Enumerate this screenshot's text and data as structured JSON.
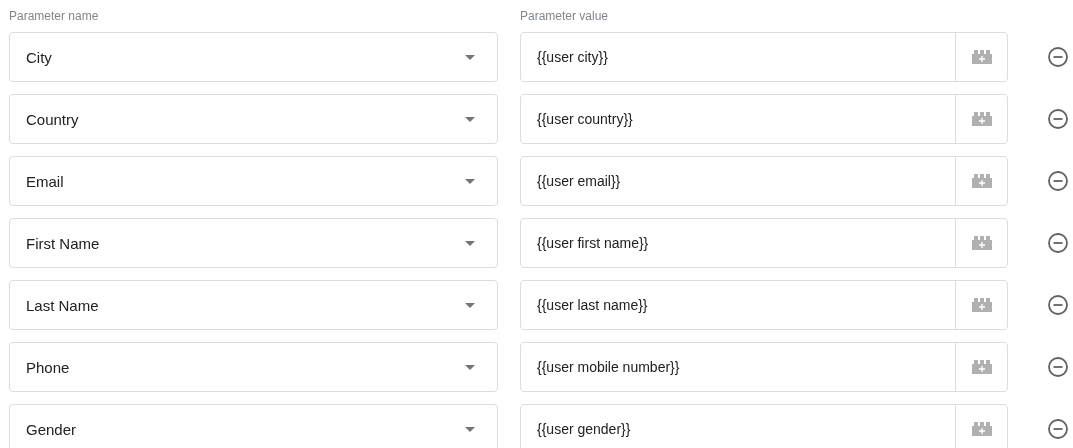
{
  "headers": {
    "name": "Parameter name",
    "value": "Parameter value"
  },
  "rows": [
    {
      "name": "City",
      "value": "{{user city}}"
    },
    {
      "name": "Country",
      "value": "{{user country}}"
    },
    {
      "name": "Email",
      "value": "{{user email}}"
    },
    {
      "name": "First Name",
      "value": "{{user first name}}"
    },
    {
      "name": "Last Name",
      "value": "{{user last name}}"
    },
    {
      "name": "Phone",
      "value": "{{user mobile number}}"
    },
    {
      "name": "Gender",
      "value": "{{user gender}}"
    }
  ]
}
